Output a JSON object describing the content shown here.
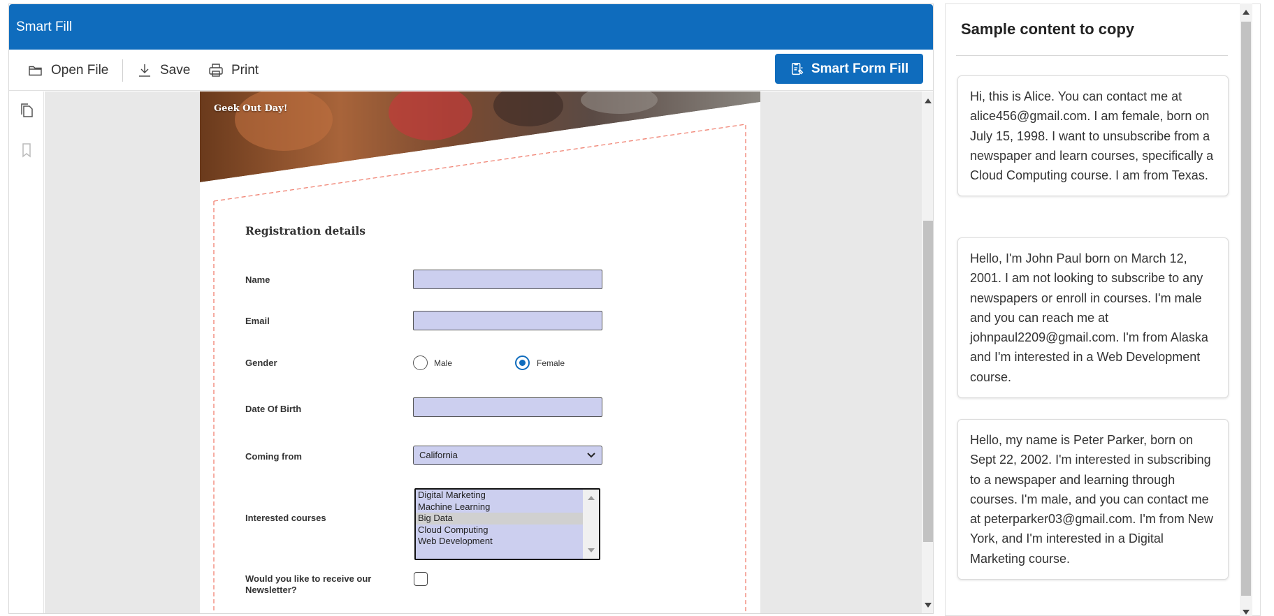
{
  "window": {
    "title": "Smart Fill"
  },
  "toolbar": {
    "open_label": "Open File",
    "save_label": "Save",
    "print_label": "Print",
    "smart_fill_label": "Smart Form Fill"
  },
  "document": {
    "banner_text": "Geek Out Day!",
    "form_title": "Registration details",
    "fields": {
      "name_label": "Name",
      "email_label": "Email",
      "gender_label": "Gender",
      "gender_options": [
        "Male",
        "Female"
      ],
      "gender_selected": "Female",
      "dob_label": "Date Of Birth",
      "coming_from_label": "Coming from",
      "coming_from_value": "California",
      "courses_label": "Interested courses",
      "courses_options": [
        "Digital Marketing",
        "Machine Learning",
        "Big Data",
        "Cloud Computing",
        "Web Development"
      ],
      "courses_highlighted": "Big Data",
      "newsletter_label_line1": "Would you like to receive our",
      "newsletter_label_line2": "Newsletter?"
    }
  },
  "samples": {
    "title": "Sample content to copy",
    "cards": [
      "Hi, this is Alice. You can contact me at alice456@gmail.com. I am female, born on July 15, 1998. I want to unsubscribe from a newspaper and learn courses, specifically a Cloud Computing course. I am from Texas.",
      "Hello, I'm John Paul born on March 12, 2001. I am not looking to subscribe to any newspapers or enroll in courses. I'm male and you can reach me at johnpaul2209@gmail.com. I'm from Alaska and I'm interested in a Web Development course.",
      "Hello, my name is Peter Parker, born on Sept 22, 2002. I'm interested in subscribing to a newspaper and learning through courses. I'm male, and you can contact me at peterparker03@gmail.com. I'm from New York, and I'm interested in a Digital Marketing course."
    ]
  },
  "colors": {
    "accent": "#0f6cbd",
    "field_fill": "#cccfef",
    "dashed_border": "#f08070"
  },
  "icons": [
    "folder-open-icon",
    "download-icon",
    "printer-icon",
    "smart-fill-icon",
    "pages-icon",
    "bookmark-icon",
    "chevron-down-icon"
  ]
}
